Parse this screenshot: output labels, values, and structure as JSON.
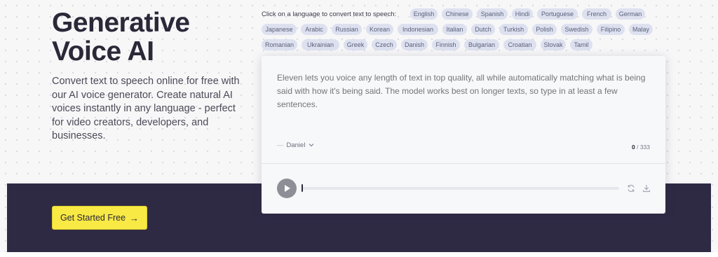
{
  "hero": {
    "title_line1": "Generative",
    "title_line2": "Voice AI",
    "description": "Convert text to speech online for free with our AI voice generator. Create natural AI voices instantly in any language - perfect for video creators, developers, and businesses.",
    "cta_label": "Get Started Free",
    "cta_icon": "arrow-right-icon"
  },
  "languages": {
    "prompt": "Click on a language to convert text to speech:",
    "items": [
      "English",
      "Chinese",
      "Spanish",
      "Hindi",
      "Portuguese",
      "French",
      "German",
      "Japanese",
      "Arabic",
      "Russian",
      "Korean",
      "Indonesian",
      "Italian",
      "Dutch",
      "Turkish",
      "Polish",
      "Swedish",
      "Filipino",
      "Malay",
      "Romanian",
      "Ukrainian",
      "Greek",
      "Czech",
      "Danish",
      "Finnish",
      "Bulgarian",
      "Croatian",
      "Slovak",
      "Tamil"
    ]
  },
  "editor": {
    "placeholder": "Eleven lets you voice any length of text in top quality, all while automatically matching what is being said with how it's being said. The model works best on longer texts, so type in at least a few sentences.",
    "voice_prefix": "—",
    "voice": "Daniel",
    "char_count_current": "0",
    "char_count_separator": "/",
    "char_count_max": "333",
    "playback_progress": 0
  },
  "colors": {
    "cta_yellow": "#f8e945",
    "dark_band": "#2f2a44",
    "chip_bg": "#dde1ef",
    "title": "#2b2838"
  },
  "icons": {
    "play": "play-icon",
    "regenerate": "refresh-icon",
    "download": "download-icon",
    "voice_dropdown": "chevron-down-icon"
  }
}
